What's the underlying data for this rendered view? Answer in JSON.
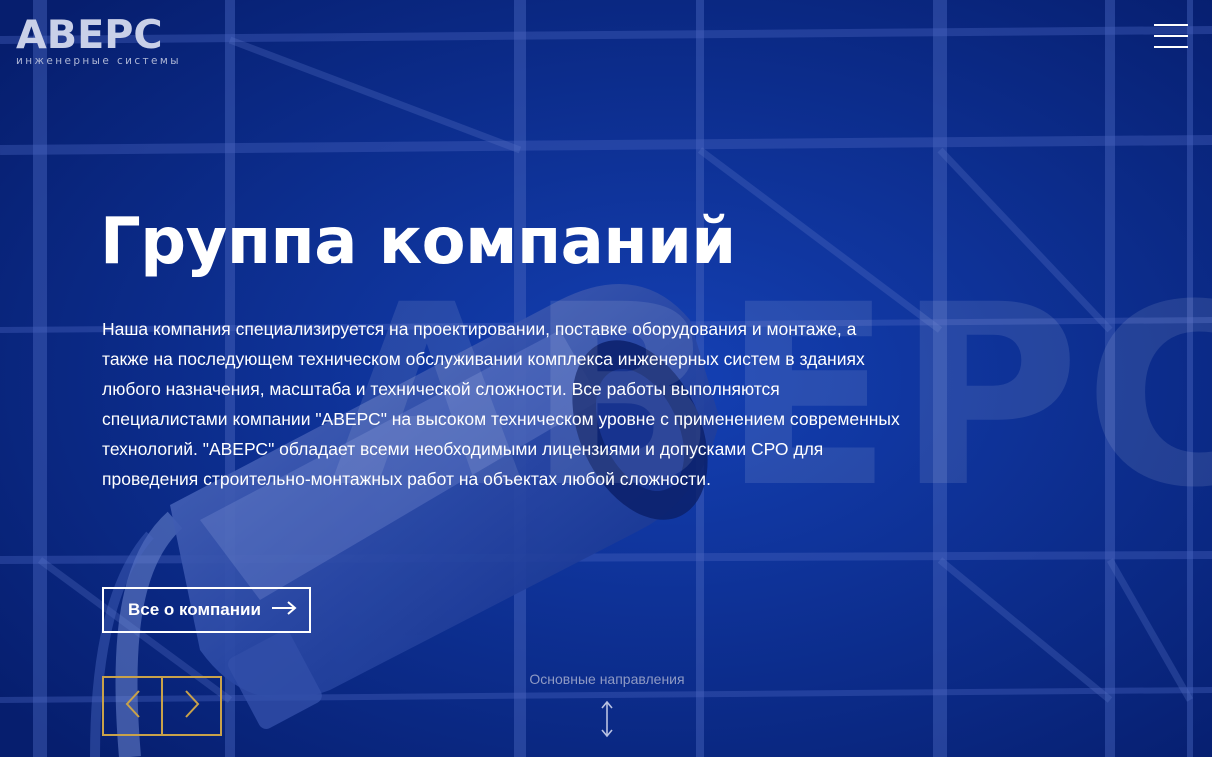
{
  "brand": {
    "logo_text": "АВЕРС",
    "logo_subtitle": "инженерные системы"
  },
  "header": {
    "menu_icon": "hamburger-menu-icon"
  },
  "hero": {
    "watermark": "АВЕРС",
    "title": "Группа компаний",
    "description": "Наша компания специализируется на проектировании, поставке оборудования и монтаже, а также на последующем техническом обслуживании комплекса инженерных систем в зданиях любого назначения, масштаба и технической сложности. Все работы выполняются специалистами компании \"АВЕРС\" на высоком техническом уровне с применением современных технологий. \"АВЕРС\" обладает всеми необходимыми лицензиями и допусками СРО для проведения строительно-монтажных работ на объектах любой сложности.",
    "about_button": "Все о компании",
    "about_icon": "arrow-right-icon"
  },
  "slider": {
    "prev_icon": "chevron-left-icon",
    "next_icon": "chevron-right-icon"
  },
  "scroll": {
    "label": "Основные направления",
    "icon": "vertical-double-arrow-icon"
  },
  "colors": {
    "overlay_blue": "#0b2d8f",
    "accent_gold": "#c9a24a",
    "muted_text": "#8f9ac4"
  }
}
